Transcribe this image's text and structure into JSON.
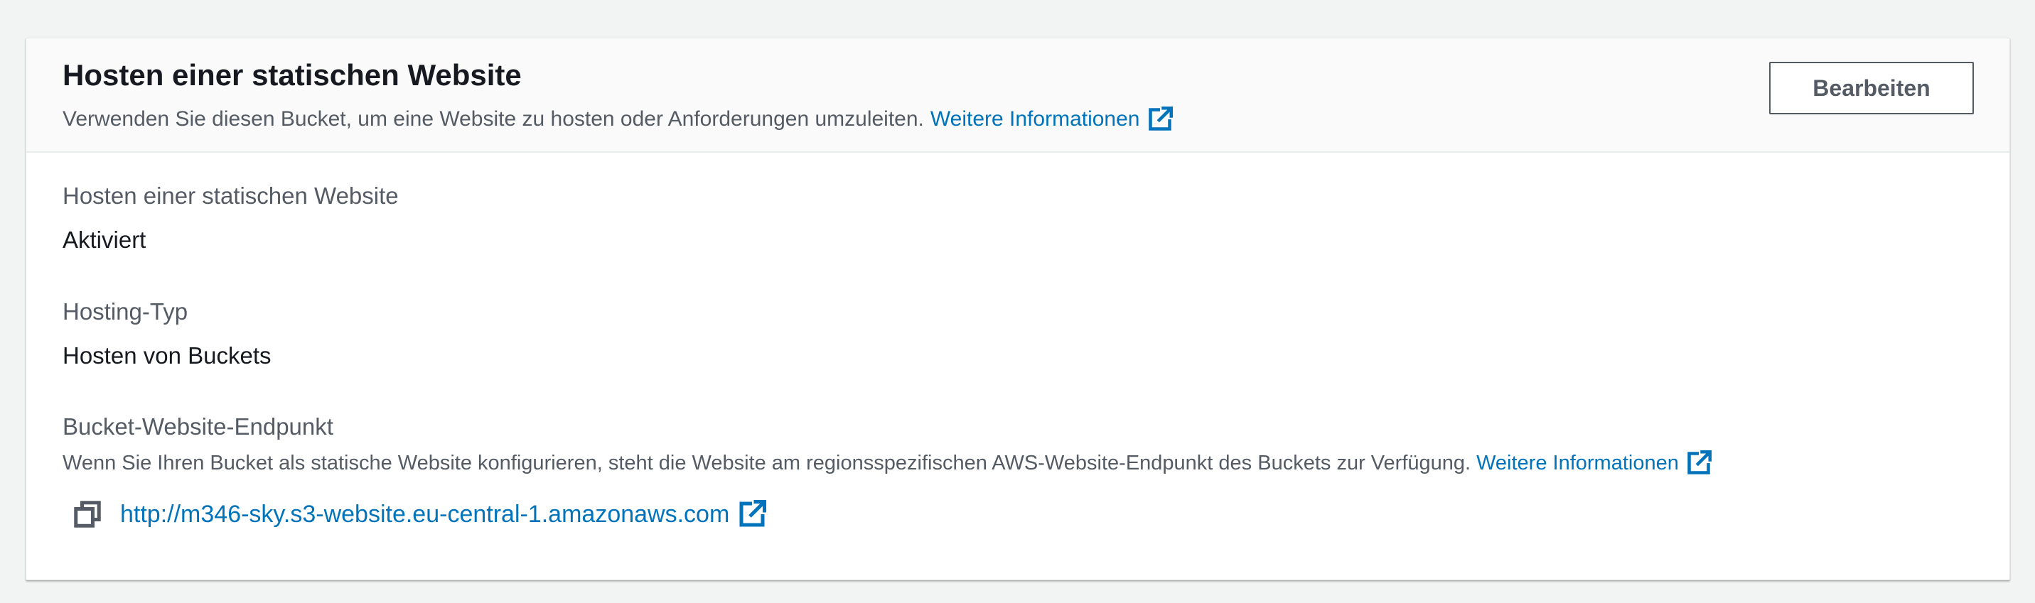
{
  "panel": {
    "title": "Hosten einer statischen Website",
    "description": "Verwenden Sie diesen Bucket, um eine Website zu hosten oder Anforderungen umzuleiten.",
    "learn_more": "Weitere Informationen",
    "edit_button": "Bearbeiten"
  },
  "fields": {
    "static_hosting": {
      "label": "Hosten einer statischen Website",
      "value": "Aktiviert"
    },
    "hosting_type": {
      "label": "Hosting-Typ",
      "value": "Hosten von Buckets"
    },
    "endpoint": {
      "label": "Bucket-Website-Endpunkt",
      "description": "Wenn Sie Ihren Bucket als statische Website konfigurieren, steht die Website am regionsspezifischen AWS-Website-Endpunkt des Buckets zur Verfügung.",
      "learn_more": "Weitere Informationen",
      "url": "http://m346-sky.s3-website.eu-central-1.amazonaws.com"
    }
  },
  "icons": {
    "external_link": "external-link-icon",
    "copy": "copy-icon"
  },
  "colors": {
    "link": "#0073bb",
    "title": "#16191f",
    "secondary_text": "#545b64",
    "header_background": "#fafafa",
    "page_background": "#f2f3f3"
  }
}
